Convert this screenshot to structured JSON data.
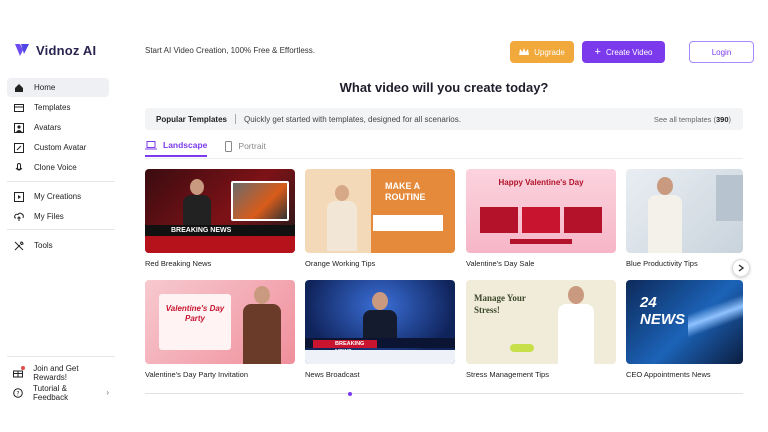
{
  "brand": {
    "name": "Vidnoz AI"
  },
  "header": {
    "tagline": "Start AI Video Creation, 100% Free & Effortless.",
    "upgrade_label": "Upgrade",
    "create_label": "Create Video",
    "login_label": "Login"
  },
  "sidebar": {
    "items": [
      {
        "label": "Home",
        "icon": "home-icon",
        "active": true
      },
      {
        "label": "Templates",
        "icon": "templates-icon"
      },
      {
        "label": "Avatars",
        "icon": "avatar-icon"
      },
      {
        "label": "Custom Avatar",
        "icon": "custom-avatar-icon"
      },
      {
        "label": "Clone Voice",
        "icon": "microphone-icon"
      },
      {
        "label": "My Creations",
        "icon": "play-icon"
      },
      {
        "label": "My Files",
        "icon": "upload-icon"
      },
      {
        "label": "Tools",
        "icon": "tools-icon"
      }
    ],
    "footer": [
      {
        "label": "Join and Get Rewards!",
        "icon": "gift-icon"
      },
      {
        "label": "Tutorial & Feedback",
        "icon": "help-icon"
      }
    ]
  },
  "main": {
    "title": "What video will you create today?",
    "popular_title": "Popular Templates",
    "popular_desc": "Quickly get started with templates, designed for all scenarios.",
    "see_all_prefix": "See all templates (",
    "see_all_count": "390",
    "see_all_suffix": ")",
    "tabs": [
      {
        "label": "Landscape",
        "active": true
      },
      {
        "label": "Portrait",
        "active": false
      }
    ],
    "templates": [
      {
        "name": "Red Breaking News",
        "thumb_text": "BREAKING NEWS"
      },
      {
        "name": "Orange Working Tips",
        "thumb_text": "MAKE A ROUTINE"
      },
      {
        "name": "Valentine's Day Sale",
        "thumb_text": "Happy Valentine's Day"
      },
      {
        "name": "Blue Productivity Tips",
        "thumb_text": ""
      },
      {
        "name": "Valentine's Day Party Invitation",
        "thumb_text": "Valentine's Day Party"
      },
      {
        "name": "News Broadcast",
        "thumb_text": "BREAKING NEWS"
      },
      {
        "name": "Stress Management Tips",
        "thumb_text": "Manage Your Stress!"
      },
      {
        "name": "CEO Appointments News",
        "thumb_text": "24 NEWS"
      }
    ]
  },
  "colors": {
    "accent": "#7c3aed",
    "upgrade": "#f0a93a"
  }
}
